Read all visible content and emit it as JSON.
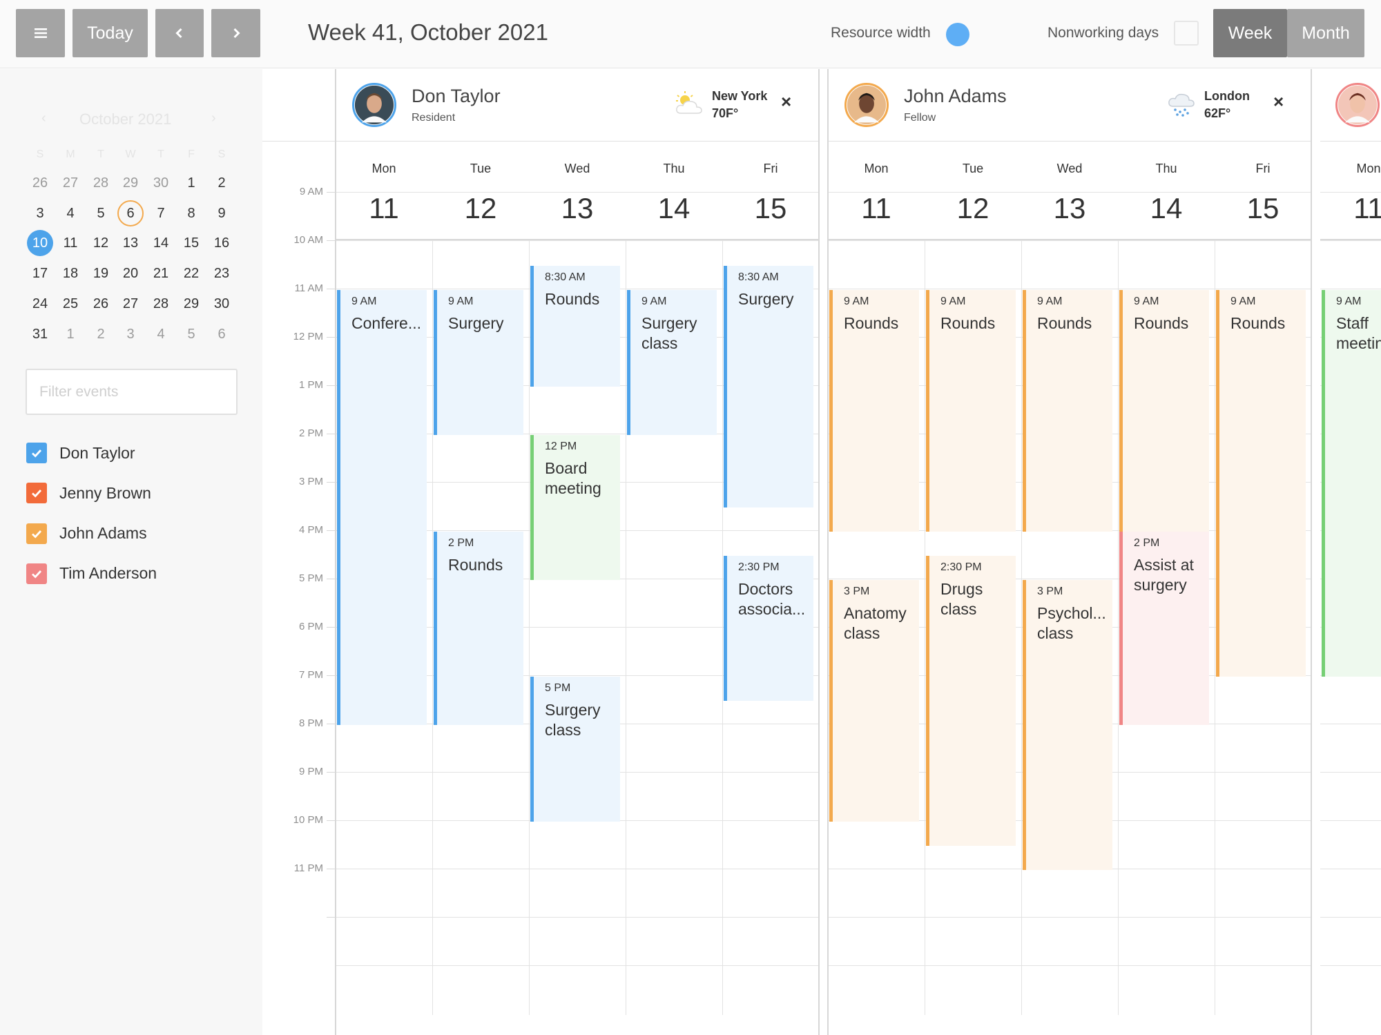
{
  "toolbar": {
    "today_label": "Today",
    "title": "Week 41, October 2021",
    "resource_width_label": "Resource width",
    "nonworking_days_label": "Nonworking days",
    "week_label": "Week",
    "month_label": "Month",
    "accent_color": "#5eaef5"
  },
  "mini_calendar": {
    "month_label": "October 2021",
    "prev": "‹",
    "next": "›",
    "weekdays": [
      "S",
      "M",
      "T",
      "W",
      "T",
      "F",
      "S"
    ],
    "weeks": [
      [
        "26",
        "27",
        "28",
        "29",
        "30",
        "1",
        "2"
      ],
      [
        "3",
        "4",
        "5",
        "6",
        "7",
        "8",
        "9"
      ],
      [
        "10",
        "11",
        "12",
        "13",
        "14",
        "15",
        "16"
      ],
      [
        "17",
        "18",
        "19",
        "20",
        "21",
        "22",
        "23"
      ],
      [
        "24",
        "25",
        "26",
        "27",
        "28",
        "29",
        "30"
      ],
      [
        "31",
        "1",
        "2",
        "3",
        "4",
        "5",
        "6"
      ]
    ],
    "today": "6",
    "selected": "10"
  },
  "filter": {
    "placeholder": "Filter events"
  },
  "resources_filter": [
    {
      "name": "Don Taylor",
      "color": "#4da3ea"
    },
    {
      "name": "Jenny Brown",
      "color": "#f26b3a"
    },
    {
      "name": "John Adams",
      "color": "#f3a94d"
    },
    {
      "name": "Tim Anderson",
      "color": "#f08585"
    }
  ],
  "time_axis": [
    "9 AM",
    "10 AM",
    "11 AM",
    "12 PM",
    "1 PM",
    "2 PM",
    "3 PM",
    "4 PM",
    "5 PM",
    "6 PM",
    "7 PM",
    "8 PM",
    "9 PM",
    "10 PM",
    "11 PM"
  ],
  "days": [
    {
      "name": "Mon",
      "num": "11"
    },
    {
      "name": "Tue",
      "num": "12"
    },
    {
      "name": "Wed",
      "num": "13"
    },
    {
      "name": "Thu",
      "num": "14"
    },
    {
      "name": "Fri",
      "num": "15"
    }
  ],
  "resources": [
    {
      "name": "Don Taylor",
      "role": "Resident",
      "city": "New York",
      "temp": "70F°",
      "weather_icon": "sun-cloud-icon",
      "events": [
        {
          "day": 0,
          "start": 9,
          "end": 18,
          "time": "9 AM",
          "title": "Confere...",
          "color": "blue"
        },
        {
          "day": 1,
          "start": 9,
          "end": 12,
          "time": "9 AM",
          "title": "Surgery",
          "color": "blue"
        },
        {
          "day": 1,
          "start": 14,
          "end": 18,
          "time": "2 PM",
          "title": "Rounds",
          "color": "blue"
        },
        {
          "day": 2,
          "start": 8.5,
          "end": 11,
          "time": "8:30 AM",
          "title": "Rounds",
          "color": "blue"
        },
        {
          "day": 2,
          "start": 12,
          "end": 15,
          "time": "12 PM",
          "title": "Board meeting",
          "color": "green"
        },
        {
          "day": 2,
          "start": 17,
          "end": 20,
          "time": "5 PM",
          "title": "Surgery class",
          "color": "blue"
        },
        {
          "day": 3,
          "start": 9,
          "end": 12,
          "time": "9 AM",
          "title": "Surgery class",
          "color": "blue"
        },
        {
          "day": 4,
          "start": 8.5,
          "end": 13.5,
          "time": "8:30 AM",
          "title": "Surgery",
          "color": "blue"
        },
        {
          "day": 4,
          "start": 14.5,
          "end": 17.5,
          "time": "2:30 PM",
          "title": "Doctors associa...",
          "color": "blue"
        }
      ]
    },
    {
      "name": "John Adams",
      "role": "Fellow",
      "city": "London",
      "temp": "62F°",
      "weather_icon": "snow-cloud-icon",
      "events": [
        {
          "day": 0,
          "start": 9,
          "end": 14,
          "time": "9 AM",
          "title": "Rounds",
          "color": "orange"
        },
        {
          "day": 0,
          "start": 15,
          "end": 20,
          "time": "3 PM",
          "title": "Anatomy class",
          "color": "orange"
        },
        {
          "day": 1,
          "start": 9,
          "end": 14,
          "time": "9 AM",
          "title": "Rounds",
          "color": "orange"
        },
        {
          "day": 1,
          "start": 14.5,
          "end": 20.5,
          "time": "2:30 PM",
          "title": "Drugs class",
          "color": "orange"
        },
        {
          "day": 2,
          "start": 9,
          "end": 14,
          "time": "9 AM",
          "title": "Rounds",
          "color": "orange"
        },
        {
          "day": 2,
          "start": 15,
          "end": 21,
          "time": "3 PM",
          "title": "Psychol... class",
          "color": "orange"
        },
        {
          "day": 3,
          "start": 9,
          "end": 14,
          "time": "9 AM",
          "title": "Rounds",
          "color": "orange"
        },
        {
          "day": 3,
          "start": 14,
          "end": 18,
          "time": "2 PM",
          "title": "Assist at surgery",
          "color": "red"
        },
        {
          "day": 4,
          "start": 9,
          "end": 17,
          "time": "9 AM",
          "title": "Rounds",
          "color": "orange"
        }
      ]
    },
    {
      "name": "",
      "role": "",
      "city": "",
      "temp": "",
      "partial_day": {
        "name": "Mon",
        "num": "11"
      },
      "events": [
        {
          "day": 0,
          "start": 9,
          "end": 17,
          "time": "9 AM",
          "title": "Staff meetin",
          "color": "green"
        }
      ]
    }
  ]
}
